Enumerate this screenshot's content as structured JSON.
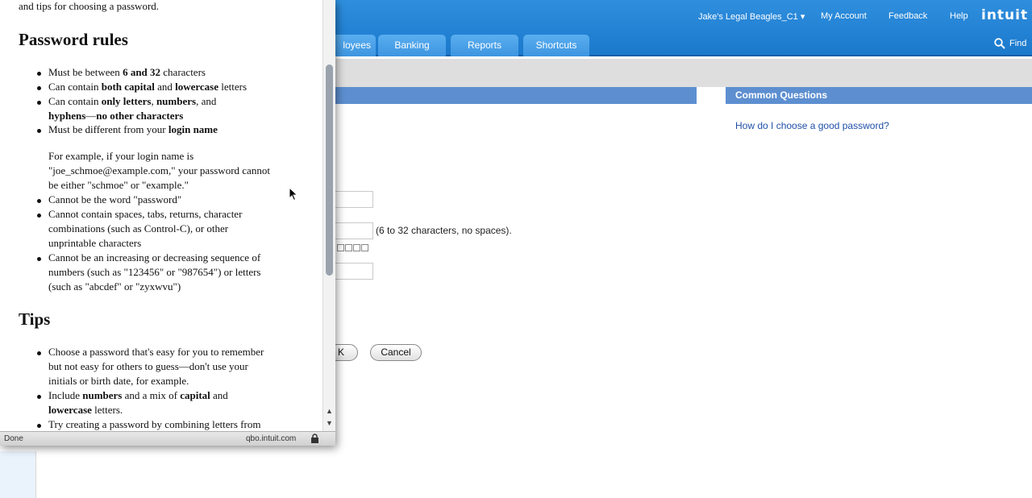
{
  "topbar": {
    "company": "Jake's Legal Beagles_C1 ▾",
    "my_account": "My Account",
    "feedback": "Feedback",
    "help": "Help",
    "logo": "intuit"
  },
  "nav": {
    "tabs": [
      "loyees",
      "Banking",
      "Reports",
      "Shortcuts"
    ],
    "find": "Find"
  },
  "common_questions": {
    "title": "Common Questions",
    "link": "How do I choose a good password?"
  },
  "form": {
    "password_hint": "(6 to 32 characters, no spaces).",
    "ok_partial": "K",
    "cancel": "Cancel"
  },
  "popup": {
    "intro": "and tips for choosing a password.",
    "rules_title": "Password rules",
    "tips_title": "Tips",
    "status": "Done",
    "status_host": "qbo.intuit.com"
  }
}
